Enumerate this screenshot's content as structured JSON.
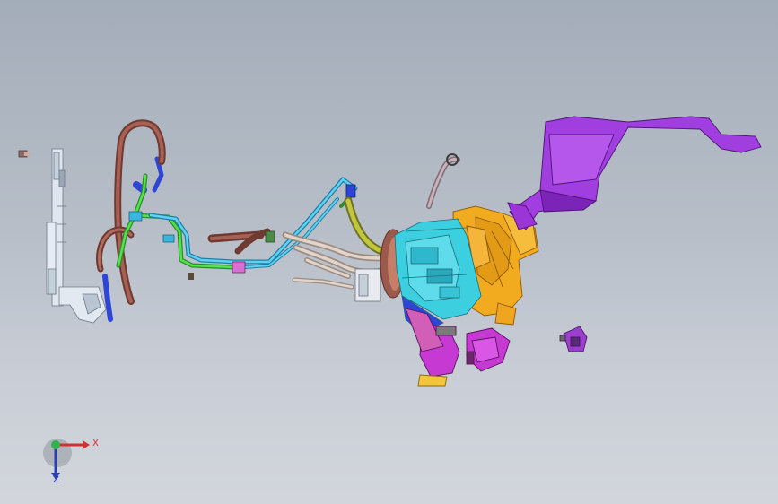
{
  "viewport": {
    "background_top": "#a3adb9",
    "background_bottom": "#d2d6dc"
  },
  "assembly": {
    "parts": [
      {
        "name": "radiator-bracket",
        "color": "#dfe6ef"
      },
      {
        "name": "brown-coolant-hose",
        "color": "#8a4a3e"
      },
      {
        "name": "blue-hose-clips",
        "color": "#2f45d6"
      },
      {
        "name": "green-coolant-line",
        "color": "#3dc43a"
      },
      {
        "name": "cyan-coolant-line",
        "color": "#37b6e0"
      },
      {
        "name": "pink-connector",
        "color": "#d86fd2"
      },
      {
        "name": "tan-rubber-hoses",
        "color": "#d7c7bd"
      },
      {
        "name": "olive-hose",
        "color": "#b8bd36"
      },
      {
        "name": "cyan-evaporator-block",
        "color": "#3ccfe0"
      },
      {
        "name": "orange-hvac-housing",
        "color": "#f2aa1f"
      },
      {
        "name": "purple-air-duct",
        "color": "#a13ee0"
      },
      {
        "name": "magenta-lower-duct",
        "color": "#c63ad3"
      },
      {
        "name": "purple-sensor-bracket",
        "color": "#9c3fce"
      }
    ]
  },
  "triad": {
    "x_label": "X",
    "z_label": "Z",
    "x_color": "#d23030",
    "y_color": "#2fb34a",
    "z_color": "#2b3fb5"
  }
}
